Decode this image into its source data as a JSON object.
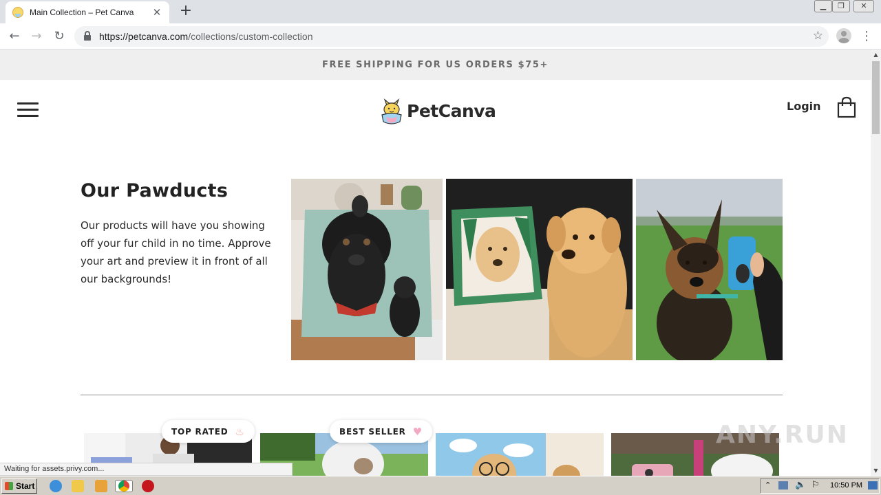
{
  "browser": {
    "tab_title": "Main Collection – Pet Canva",
    "url_domain": "https://petcanva.com",
    "url_path": "/collections/custom-collection",
    "status_text": "Waiting for assets.privy.com..."
  },
  "site": {
    "announcement": "FREE SHIPPING FOR US ORDERS $75+",
    "logo_text": "PetCanva",
    "login_label": "Login",
    "brand_colors": {
      "text": "#2a2a2a",
      "announce_bg": "#efefef",
      "divider": "#8a8a8a"
    }
  },
  "hero": {
    "heading": "Our Pawducts",
    "description": "Our products will have you showing off your fur child in no time. Approve your art and preview it in front of all our backgrounds!"
  },
  "badges": [
    {
      "label": "TOP RATED",
      "icon": "flame-icon"
    },
    {
      "label": "BEST SELLER",
      "icon": "heart-icon"
    }
  ],
  "watermark": "ANY.RUN",
  "taskbar": {
    "start_label": "Start",
    "clock": "10:50 PM"
  }
}
